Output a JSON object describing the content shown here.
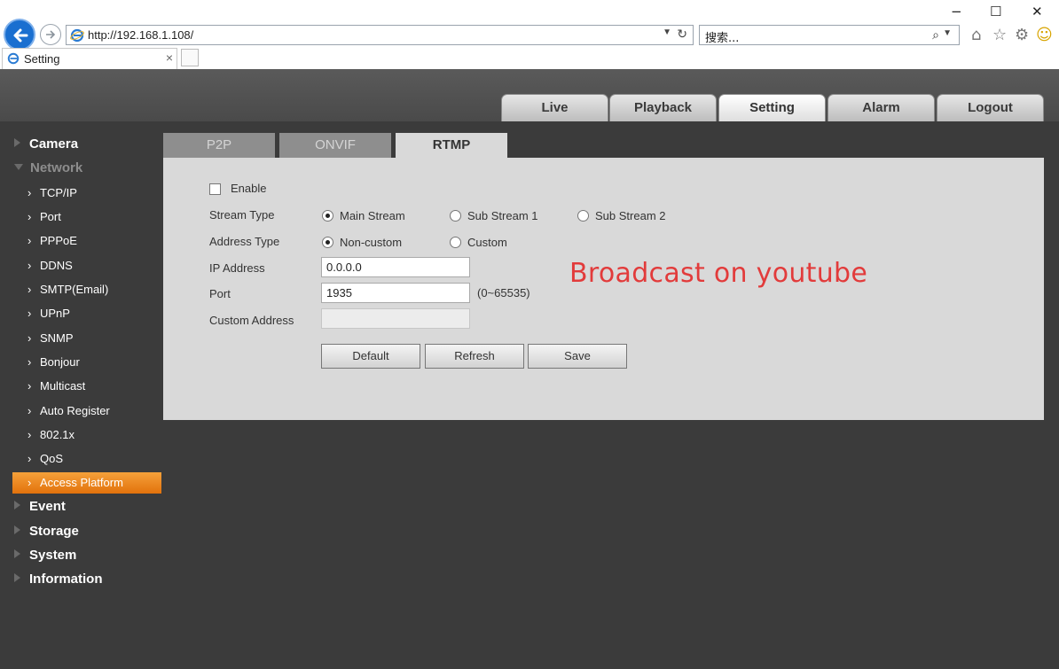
{
  "browser": {
    "window_controls": {
      "minimize": "−",
      "maximize": "☐",
      "close": "✕"
    },
    "address": "http://192.168.1.108/",
    "search_placeholder": "搜索...",
    "tab_title": "Setting"
  },
  "topnav": {
    "items": [
      {
        "label": "Live",
        "active": false
      },
      {
        "label": "Playback",
        "active": false
      },
      {
        "label": "Setting",
        "active": true
      },
      {
        "label": "Alarm",
        "active": false
      },
      {
        "label": "Logout",
        "active": false
      }
    ]
  },
  "sidebar": {
    "groups": [
      {
        "label": "Camera",
        "open": false
      },
      {
        "label": "Network",
        "open": true
      },
      {
        "label": "Event",
        "open": false
      },
      {
        "label": "Storage",
        "open": false
      },
      {
        "label": "System",
        "open": false
      },
      {
        "label": "Information",
        "open": false
      }
    ],
    "network_items": [
      {
        "label": "TCP/IP"
      },
      {
        "label": "Port"
      },
      {
        "label": "PPPoE"
      },
      {
        "label": "DDNS"
      },
      {
        "label": "SMTP(Email)"
      },
      {
        "label": "UPnP"
      },
      {
        "label": "SNMP"
      },
      {
        "label": "Bonjour"
      },
      {
        "label": "Multicast"
      },
      {
        "label": "Auto Register"
      },
      {
        "label": "802.1x"
      },
      {
        "label": "QoS"
      },
      {
        "label": "Access Platform",
        "active": true
      }
    ]
  },
  "subtabs": [
    {
      "label": "P2P",
      "active": false
    },
    {
      "label": "ONVIF",
      "active": false
    },
    {
      "label": "RTMP",
      "active": true
    }
  ],
  "form": {
    "enable_label": "Enable",
    "enable_checked": false,
    "stream_type_label": "Stream Type",
    "stream_options": [
      {
        "label": "Main Stream",
        "checked": true
      },
      {
        "label": "Sub Stream 1",
        "checked": false
      },
      {
        "label": "Sub Stream 2",
        "checked": false
      }
    ],
    "address_type_label": "Address Type",
    "address_options": [
      {
        "label": "Non-custom",
        "checked": true
      },
      {
        "label": "Custom",
        "checked": false
      }
    ],
    "ip_label": "IP Address",
    "ip_value": "0.0.0.0",
    "port_label": "Port",
    "port_value": "1935",
    "port_hint": "(0~65535)",
    "custom_address_label": "Custom Address",
    "custom_address_value": "",
    "buttons": {
      "default": "Default",
      "refresh": "Refresh",
      "save": "Save"
    }
  },
  "overlay_note": "Broadcast on youtube",
  "colors": {
    "accent_orange": "#f08a1c",
    "note_red": "#e23b3b",
    "page_bg": "#3b3b3b",
    "panel_bg": "#d9d9d9"
  }
}
